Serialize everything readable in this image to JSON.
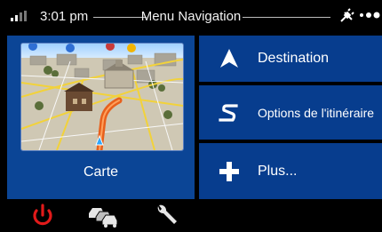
{
  "status_bar": {
    "time": "3:01 pm",
    "title": "Menu Navigation"
  },
  "tiles": {
    "map": {
      "label": "Carte"
    },
    "destination": {
      "label": "Destination",
      "icon": "navigation-arrow-icon"
    },
    "route_options": {
      "label": "Options de l'itinéraire",
      "icon": "route-s-icon"
    },
    "more": {
      "label": "Plus...",
      "icon": "plus-icon"
    }
  },
  "toolbar": {
    "items": [
      {
        "icon": "power-icon",
        "color": "#e11a1a"
      },
      {
        "icon": "traffic-icon"
      },
      {
        "icon": "wrench-icon"
      }
    ]
  },
  "colors": {
    "tile_background": "#073d8e",
    "screen_background": "#000000",
    "route_color": "#e8601c"
  }
}
